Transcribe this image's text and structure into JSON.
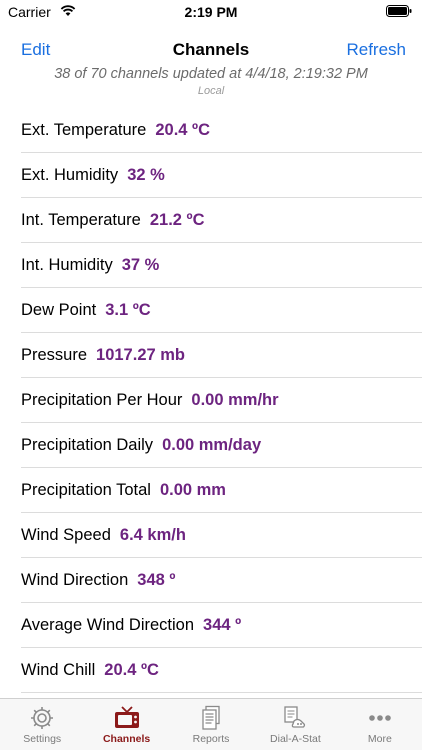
{
  "status_bar": {
    "carrier": "Carrier",
    "time": "2:19 PM"
  },
  "nav": {
    "edit_label": "Edit",
    "title": "Channels",
    "refresh_label": "Refresh"
  },
  "header": {
    "update_status": "38 of 70 channels updated at 4/4/18, 2:19:32 PM",
    "timezone": "Local"
  },
  "channels": [
    {
      "label": "Ext. Temperature",
      "value": "20.4 ºC"
    },
    {
      "label": "Ext. Humidity",
      "value": "32 %"
    },
    {
      "label": "Int. Temperature",
      "value": "21.2 ºC"
    },
    {
      "label": "Int. Humidity",
      "value": "37 %"
    },
    {
      "label": "Dew Point",
      "value": "3.1 ºC"
    },
    {
      "label": "Pressure",
      "value": "1017.27 mb"
    },
    {
      "label": "Precipitation Per Hour",
      "value": "0.00 mm/hr"
    },
    {
      "label": "Precipitation Daily",
      "value": "0.00 mm/day"
    },
    {
      "label": "Precipitation Total",
      "value": "0.00 mm"
    },
    {
      "label": "Wind Speed",
      "value": "6.4 km/h"
    },
    {
      "label": "Wind Direction",
      "value": "348 º"
    },
    {
      "label": "Average Wind Direction",
      "value": "344 º"
    },
    {
      "label": "Wind Chill",
      "value": "20.4 ºC"
    }
  ],
  "tabs": [
    {
      "label": "Settings",
      "icon": "gear-icon"
    },
    {
      "label": "Channels",
      "icon": "tv-icon",
      "active": true
    },
    {
      "label": "Reports",
      "icon": "reports-icon"
    },
    {
      "label": "Dial-A-Stat",
      "icon": "dial-a-stat-icon"
    },
    {
      "label": "More",
      "icon": "more-icon"
    }
  ],
  "colors": {
    "accent": "#1a6fe0",
    "value": "#6d2480",
    "active_tab": "#8b1a1a"
  }
}
